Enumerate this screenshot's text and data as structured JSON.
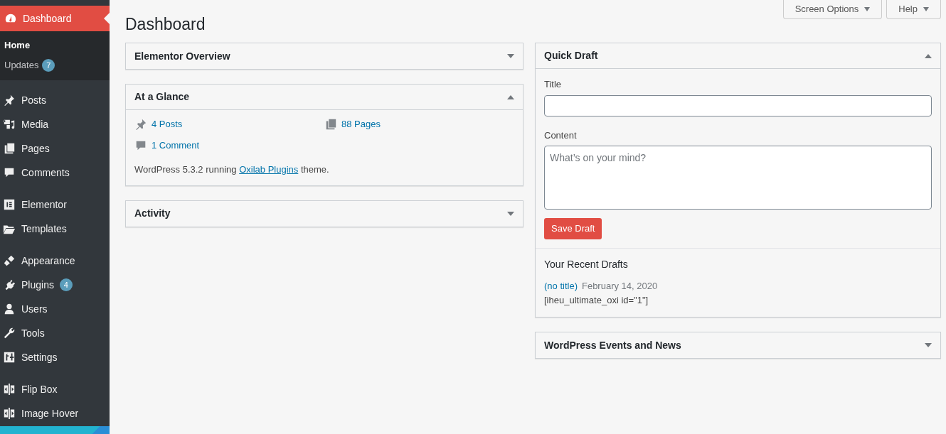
{
  "sidebar": {
    "active": {
      "label": "Dashboard",
      "selected": true
    },
    "submenu": [
      {
        "label": "Home",
        "selected": true
      },
      {
        "label": "Updates",
        "selected": false,
        "badge": "7"
      }
    ],
    "groups": [
      [
        {
          "label": "Posts"
        },
        {
          "label": "Media"
        },
        {
          "label": "Pages"
        },
        {
          "label": "Comments"
        }
      ],
      [
        {
          "label": "Elementor"
        },
        {
          "label": "Templates"
        }
      ],
      [
        {
          "label": "Appearance"
        },
        {
          "label": "Plugins",
          "badge": "4"
        },
        {
          "label": "Users"
        },
        {
          "label": "Tools"
        },
        {
          "label": "Settings"
        }
      ],
      [
        {
          "label": "Flip Box"
        },
        {
          "label": "Image Hover"
        }
      ]
    ]
  },
  "header": {
    "title": "Dashboard",
    "buttons": [
      "Screen Options",
      "Help"
    ]
  },
  "left_column": [
    {
      "title": "Elementor Overview",
      "expanded": false
    },
    {
      "kind": "glance",
      "title": "At a Glance",
      "expanded": true,
      "items": [
        "4 Posts",
        "88 Pages",
        "1 Comment"
      ],
      "footer": {
        "before": "WordPress 5.3.2 running ",
        "link": "Oxilab Plugins",
        "after": " theme."
      }
    },
    {
      "title": "Activity",
      "expanded": false
    }
  ],
  "right_column": [
    {
      "kind": "draft",
      "title": "Quick Draft",
      "expanded": true,
      "title_label": "Title",
      "content_label": "Content",
      "placeholder": "What’s on your mind?",
      "button": "Save Draft",
      "recent_heading": "Your Recent Drafts",
      "drafts": [
        {
          "title": "(no title)",
          "date": "February 14, 2020",
          "excerpt": "[iheu_ultimate_oxi id=\"1\"]"
        }
      ]
    },
    {
      "title": "WordPress Events and News",
      "expanded": false
    }
  ]
}
